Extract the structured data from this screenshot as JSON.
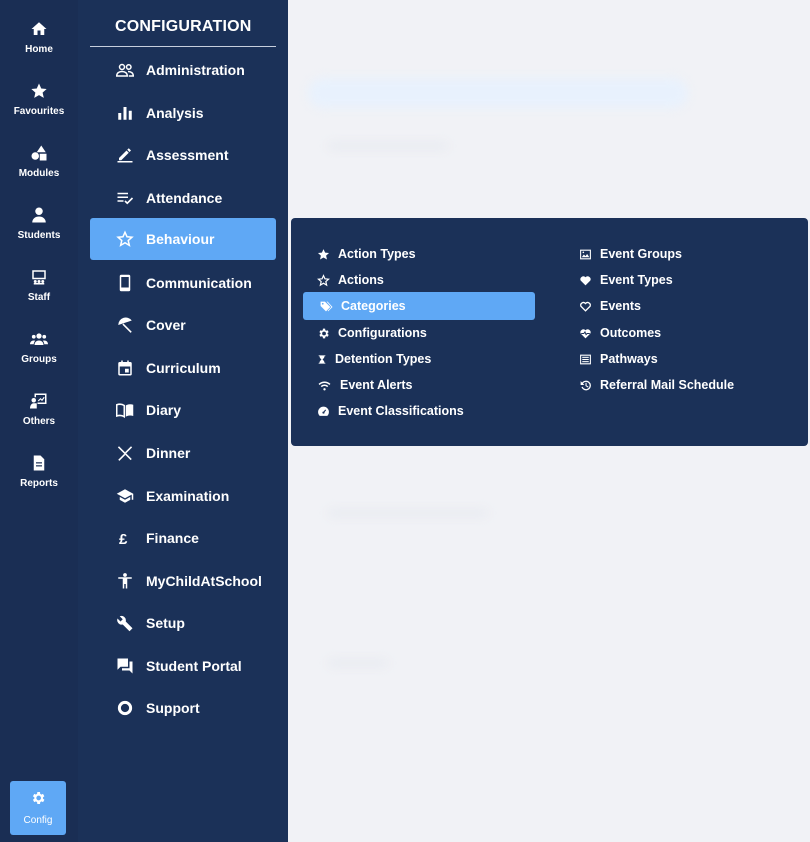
{
  "rail": {
    "items": [
      {
        "label": "Home",
        "icon": "home-icon"
      },
      {
        "label": "Favourites",
        "icon": "star-icon"
      },
      {
        "label": "Modules",
        "icon": "shapes-icon"
      },
      {
        "label": "Students",
        "icon": "person-icon"
      },
      {
        "label": "Staff",
        "icon": "staff-icon"
      },
      {
        "label": "Groups",
        "icon": "group-icon"
      },
      {
        "label": "Others",
        "icon": "presentation-icon"
      },
      {
        "label": "Reports",
        "icon": "document-icon"
      }
    ],
    "config": {
      "label": "Config",
      "icon": "gear-icon"
    }
  },
  "panel": {
    "title": "CONFIGURATION",
    "items": [
      {
        "label": "Administration",
        "icon": "people-icon"
      },
      {
        "label": "Analysis",
        "icon": "bar-chart-icon"
      },
      {
        "label": "Assessment",
        "icon": "pen-icon"
      },
      {
        "label": "Attendance",
        "icon": "checklist-icon"
      },
      {
        "label": "Behaviour",
        "icon": "star-outline-icon",
        "active": true
      },
      {
        "label": "Communication",
        "icon": "phone-icon"
      },
      {
        "label": "Cover",
        "icon": "umbrella-icon"
      },
      {
        "label": "Curriculum",
        "icon": "calendar-icon"
      },
      {
        "label": "Diary",
        "icon": "book-icon"
      },
      {
        "label": "Dinner",
        "icon": "cutlery-icon"
      },
      {
        "label": "Examination",
        "icon": "graduation-cap-icon"
      },
      {
        "label": "Finance",
        "icon": "pound-icon"
      },
      {
        "label": "MyChildAtSchool",
        "icon": "child-icon"
      },
      {
        "label": "Setup",
        "icon": "wrench-icon"
      },
      {
        "label": "Student Portal",
        "icon": "chat-icon"
      },
      {
        "label": "Support",
        "icon": "ring-icon"
      }
    ]
  },
  "flyout": {
    "left": [
      {
        "label": "Action Types",
        "icon": "star-icon"
      },
      {
        "label": "Actions",
        "icon": "star-outline-icon"
      },
      {
        "label": "Categories",
        "icon": "tags-icon",
        "active": true
      },
      {
        "label": "Configurations",
        "icon": "gear-icon"
      },
      {
        "label": "Detention Types",
        "icon": "hourglass-icon"
      },
      {
        "label": "Event Alerts",
        "icon": "wifi-icon"
      },
      {
        "label": "Event Classifications",
        "icon": "gauge-icon"
      }
    ],
    "right": [
      {
        "label": "Event Groups",
        "icon": "image-icon"
      },
      {
        "label": "Event Types",
        "icon": "heart-icon"
      },
      {
        "label": "Events",
        "icon": "heart-outline-icon"
      },
      {
        "label": "Outcomes",
        "icon": "heart-pulse-icon"
      },
      {
        "label": "Pathways",
        "icon": "list-icon"
      },
      {
        "label": "Referral Mail Schedule",
        "icon": "history-icon"
      }
    ]
  }
}
